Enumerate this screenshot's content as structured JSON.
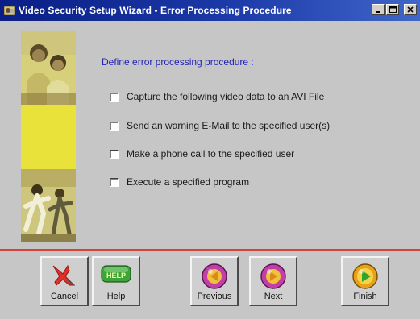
{
  "window": {
    "title": "Video Security Setup Wizard - Error Processing Procedure"
  },
  "main": {
    "heading": "Define error processing procedure :",
    "options": [
      {
        "label": "Capture the following video data to an AVI File",
        "checked": false
      },
      {
        "label": "Send an warning E-Mail to the specified user(s)",
        "checked": false
      },
      {
        "label": "Make a phone call to the specified user",
        "checked": false
      },
      {
        "label": "Execute a specified program",
        "checked": false
      }
    ]
  },
  "footer": {
    "cancel_label": "Cancel",
    "help_label": "Help",
    "help_icon_text": "HELP",
    "previous_label": "Previous",
    "next_label": "Next",
    "finish_label": "Finish"
  },
  "colors": {
    "titlebar": "#0a1e86",
    "heading": "#2424b8",
    "divider": "#d6413a"
  }
}
